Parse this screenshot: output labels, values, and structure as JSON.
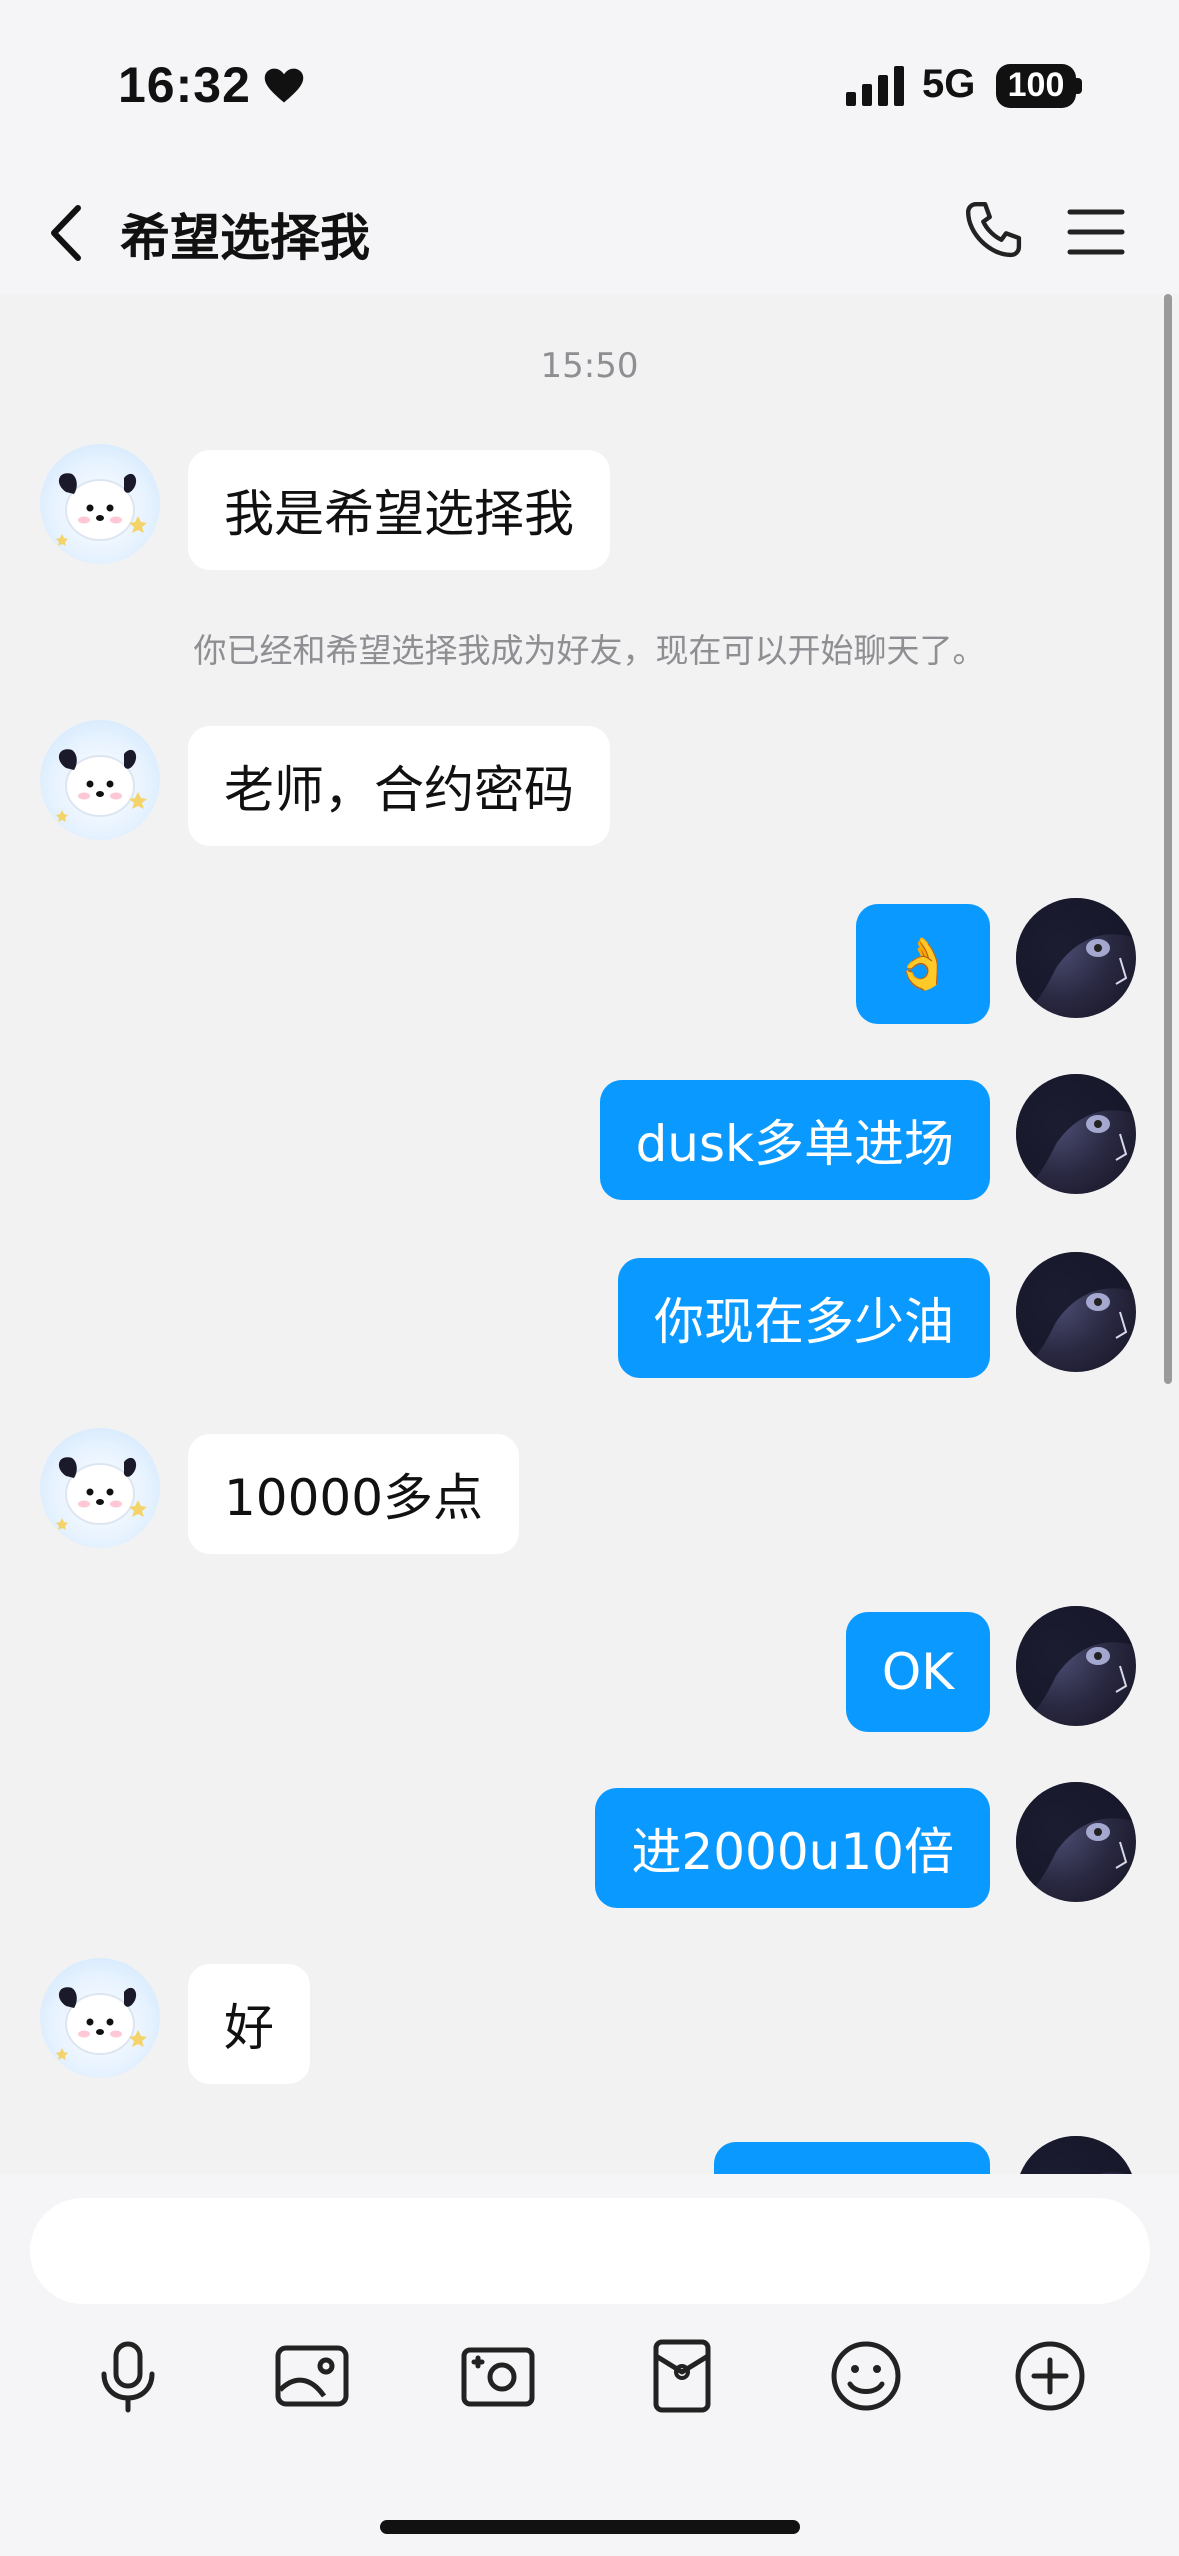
{
  "status_bar": {
    "time": "16:32",
    "network": "5G",
    "battery": "100"
  },
  "header": {
    "title": "希望选择我"
  },
  "chat": {
    "timestamp": "15:50",
    "system_notice": "你已经和希望选择我成为好友，现在可以开始聊天了。",
    "messages": [
      {
        "side": "left",
        "text": "我是希望选择我"
      },
      {
        "side": "left",
        "text": "老师，合约密码"
      },
      {
        "side": "right",
        "text": "👌"
      },
      {
        "side": "right",
        "text": "dusk多单进场"
      },
      {
        "side": "right",
        "text": "你现在多少油"
      },
      {
        "side": "left",
        "text": "10000多点"
      },
      {
        "side": "right",
        "text": "OK"
      },
      {
        "side": "right",
        "text": "进2000u10倍"
      },
      {
        "side": "left",
        "text": "好"
      }
    ]
  },
  "input": {
    "placeholder": "",
    "value": ""
  },
  "toolbar": {
    "icons": [
      "microphone-icon",
      "image-icon",
      "camera-icon",
      "red-packet-icon",
      "emoji-icon",
      "plus-icon"
    ]
  },
  "colors": {
    "accent_blue": "#0a99ff",
    "background": "#f2f2f2",
    "bar_background": "#f5f5f7",
    "timestamp_gray": "#8e8e93"
  }
}
